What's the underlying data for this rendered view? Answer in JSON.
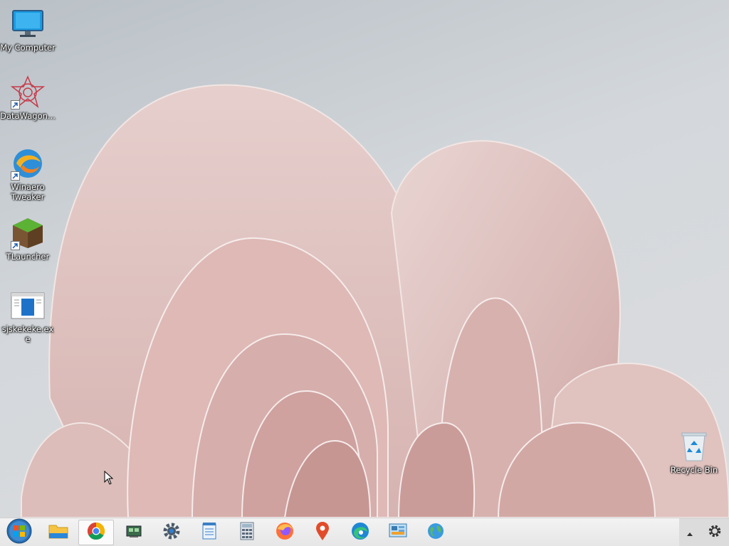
{
  "desktop": {
    "icons": [
      {
        "label": "My Computer",
        "icon": "monitor-icon"
      },
      {
        "label": "DataWagon...",
        "icon": "datawagon-icon"
      },
      {
        "label": "Winaero Tweaker",
        "icon": "winaero-tweaker-icon"
      },
      {
        "label": "TLauncher",
        "icon": "tlauncher-icon"
      },
      {
        "label": "sjskekeke.exe",
        "icon": "exe-file-icon"
      },
      {
        "label": "Recycle Bin",
        "icon": "recycle-bin-icon"
      }
    ]
  },
  "taskbar": {
    "items": [
      {
        "icon": "start-orb-icon"
      },
      {
        "icon": "file-explorer-icon"
      },
      {
        "icon": "chrome-icon",
        "active": true
      },
      {
        "icon": "system-tool-icon"
      },
      {
        "icon": "settings-gear-icon"
      },
      {
        "icon": "notepad-icon"
      },
      {
        "icon": "calculator-icon"
      },
      {
        "icon": "firefox-icon"
      },
      {
        "icon": "maps-pin-icon"
      },
      {
        "icon": "edge-icon"
      },
      {
        "icon": "control-panel-icon"
      },
      {
        "icon": "network-globe-icon"
      }
    ],
    "tray": [
      {
        "icon": "show-hidden-icons-icon"
      },
      {
        "icon": "gear-icon"
      }
    ]
  },
  "colors": {
    "taskbar": "#ececec",
    "accent": "#1e73c8",
    "petal": "#e3c8c6"
  }
}
